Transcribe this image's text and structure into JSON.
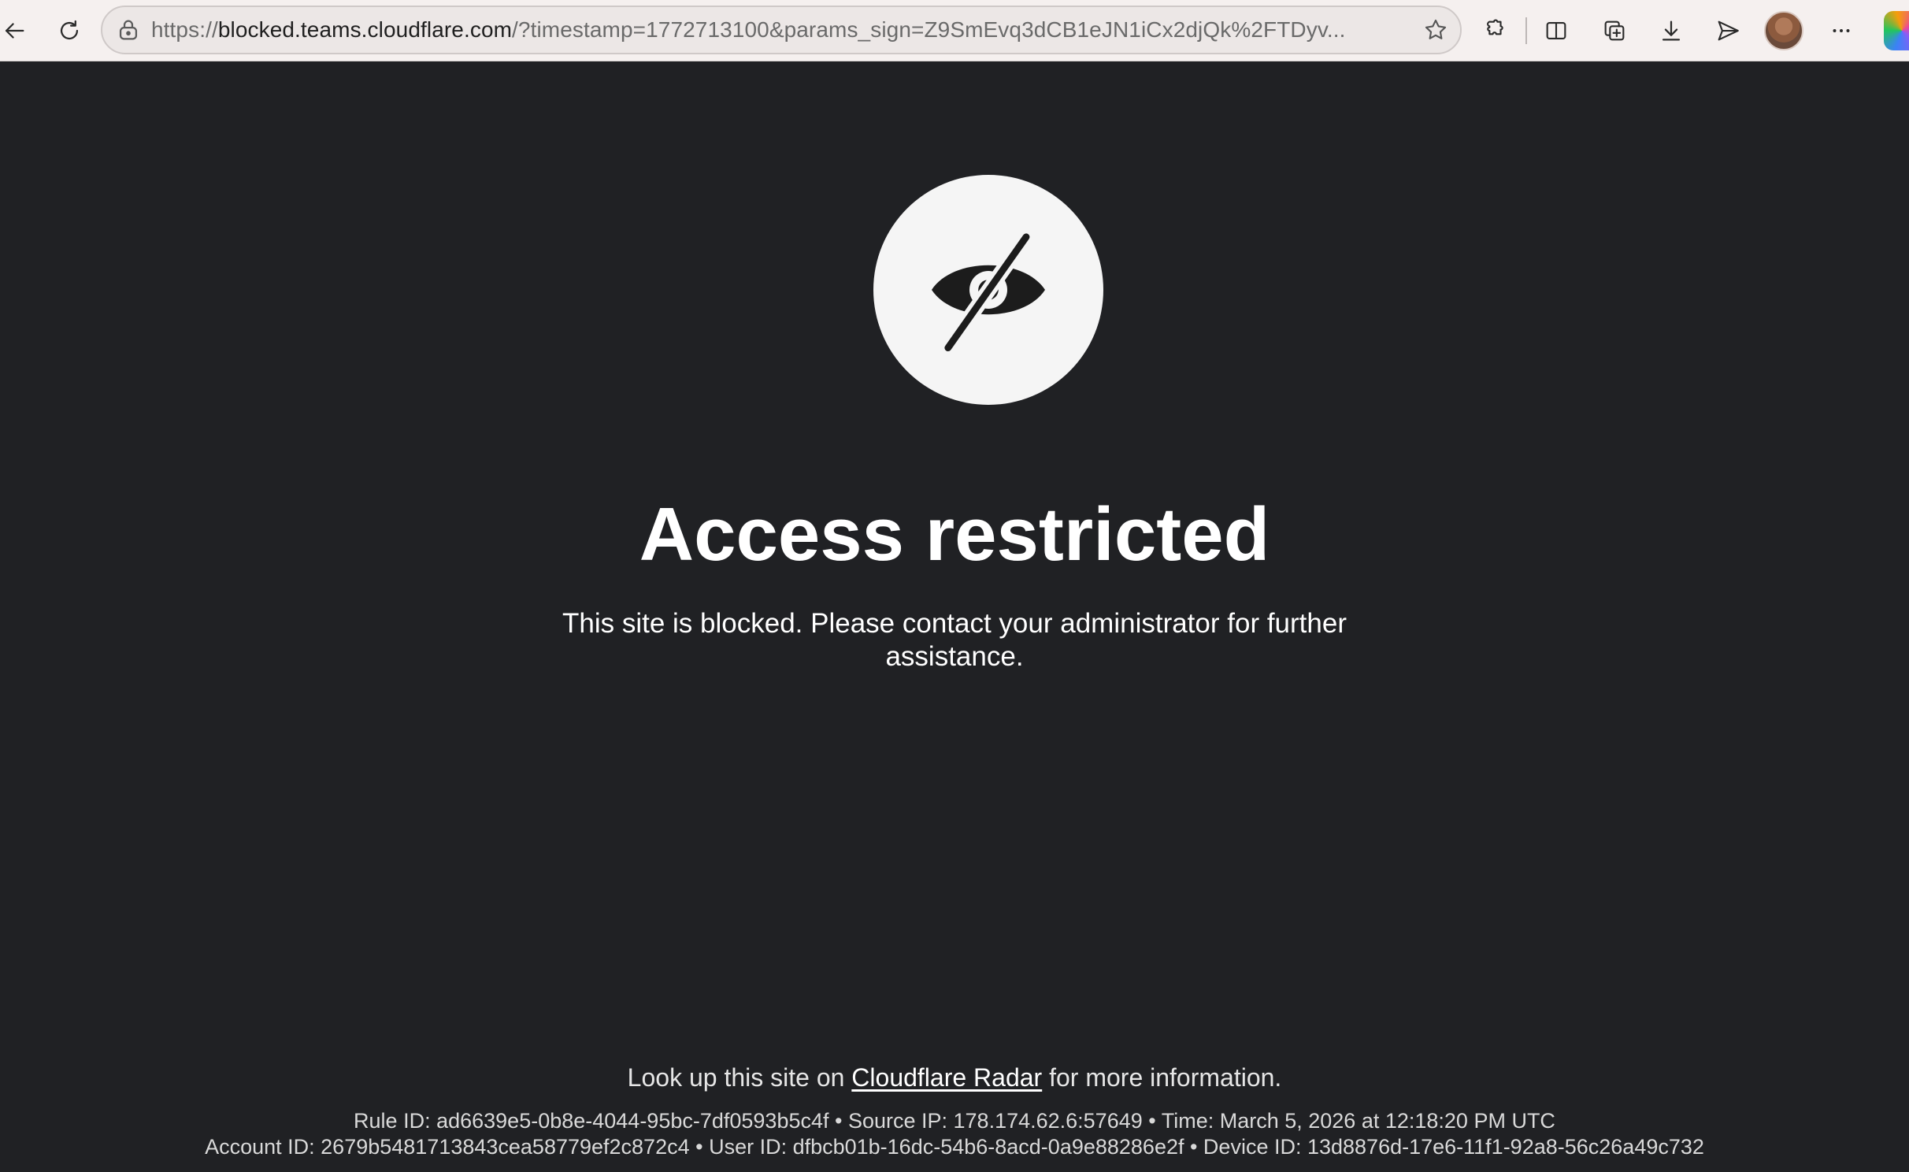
{
  "browser": {
    "url_scheme": "https://",
    "url_host": "blocked.teams.cloudflare.com",
    "url_rest": "/?timestamp=1772713100&params_sign=Z9SmEvq3dCB1eJN1iCx2djQk%2FTDyv...",
    "icons": [
      "back-arrow-icon",
      "reload-icon",
      "lock-icon",
      "star-icon",
      "extensions-icon",
      "split-screen-icon",
      "collections-icon",
      "download-icon",
      "share-icon",
      "avatar",
      "more-icon",
      "copilot-icon"
    ]
  },
  "page": {
    "title": "Access restricted",
    "message": "This site is blocked. Please contact your administrator for further assistance.",
    "radar_prefix": "Look up this site on ",
    "radar_link": "Cloudflare Radar",
    "radar_suffix": " for more information.",
    "meta_line1": "Rule ID: ad6639e5-0b8e-4044-95bc-7df0593b5c4f • Source IP: 178.174.62.6:57649 • Time: March 5, 2026 at 12:18:20 PM UTC",
    "meta_line2": "Account ID: 2679b5481713843cea58779ef2c872c4 • User ID: dfbcb01b-16dc-54b6-8acd-0a9e88286e2f • Device ID: 13d8876d-17e6-11f1-92a8-56c26a49c732"
  },
  "colors": {
    "page_background": "#202124",
    "toolbar_background": "#f5f0ef",
    "badge_background": "#f5f5f5",
    "text": "#ffffff"
  }
}
